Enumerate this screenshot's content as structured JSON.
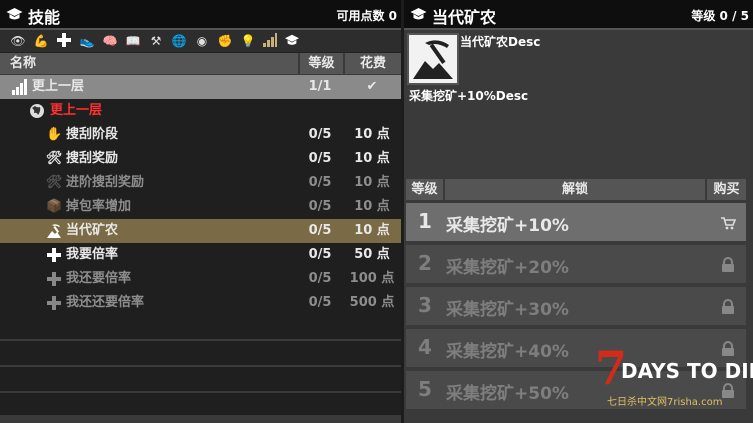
{
  "skills_panel": {
    "title": "技能",
    "points_label": "可用点数 0",
    "columns": {
      "name": "名称",
      "level": "等级",
      "cost": "花费"
    },
    "filter_icons": [
      "eye-icon",
      "flex-arm-icon",
      "plus-icon",
      "boot-icon",
      "brain-icon",
      "book-icon",
      "hammer-pick-icon",
      "globe-icon",
      "sphere-icon",
      "fist-icon",
      "light-icon",
      "signal-bars-icon",
      "grad-cap-icon"
    ],
    "rows": [
      {
        "name": "更上一层",
        "level": "1/1",
        "cost": "✔",
        "icon": "signal-bars-icon",
        "state": "header"
      },
      {
        "name": "更上一层",
        "level": "",
        "cost": "",
        "icon": "globe-icon",
        "state": "category"
      },
      {
        "name": "搜刮阶段",
        "level": "0/5",
        "cost": "10 点",
        "icon": "hand-icon",
        "state": "active"
      },
      {
        "name": "搜刮奖励",
        "level": "0/5",
        "cost": "10 点",
        "icon": "tools-icon",
        "state": "active"
      },
      {
        "name": "进阶搜刮奖励",
        "level": "0/5",
        "cost": "10 点",
        "icon": "tools-icon",
        "state": "locked"
      },
      {
        "name": "掉包率增加",
        "level": "0/5",
        "cost": "10 点",
        "icon": "crate-icon",
        "state": "locked"
      },
      {
        "name": "当代矿农",
        "level": "0/5",
        "cost": "10 点",
        "icon": "mining-icon",
        "state": "selected"
      },
      {
        "name": "我要倍率",
        "level": "0/5",
        "cost": "50 点",
        "icon": "plus-icon",
        "state": "active"
      },
      {
        "name": "我还要倍率",
        "level": "0/5",
        "cost": "100 点",
        "icon": "plus-icon",
        "state": "locked"
      },
      {
        "name": "我还还要倍率",
        "level": "0/5",
        "cost": "500 点",
        "icon": "plus-icon",
        "state": "locked"
      }
    ]
  },
  "detail_panel": {
    "title": "当代矿农",
    "level_label": "等级 0 / 5",
    "desc_title": "当代矿农Desc",
    "desc_body": "采集挖矿+10%Desc",
    "columns": {
      "level": "等级",
      "unlock": "解锁",
      "buy": "购买"
    },
    "levels": [
      {
        "num": "1",
        "text": "采集挖矿+10%",
        "action": "cart-icon",
        "state": "available"
      },
      {
        "num": "2",
        "text": "采集挖矿+20%",
        "action": "lock-icon",
        "state": "locked"
      },
      {
        "num": "3",
        "text": "采集挖矿+30%",
        "action": "lock-icon",
        "state": "locked"
      },
      {
        "num": "4",
        "text": "采集挖矿+40%",
        "action": "lock-icon",
        "state": "locked"
      },
      {
        "num": "5",
        "text": "采集挖矿+50%",
        "action": "lock-icon",
        "state": "locked"
      }
    ]
  },
  "watermark": {
    "brand": "DAYS TO DIE",
    "digit": "7",
    "sub": "七日杀中文网7risha.com"
  },
  "colors": {
    "selected_row": "#7a6a45",
    "header_row": "#8a8a8a",
    "category_text": "#ff3030",
    "row_bg": "#1f1f1f",
    "accent_red": "#d42a1a"
  }
}
